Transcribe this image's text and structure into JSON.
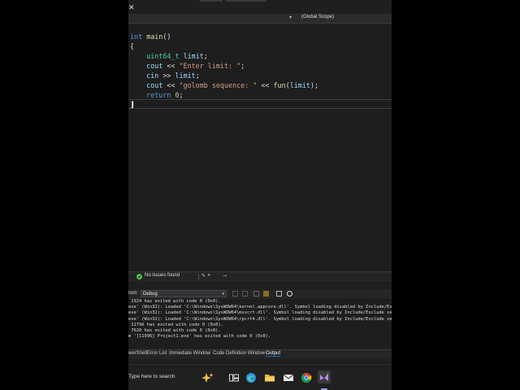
{
  "navigation": {
    "scope": "(Global Scope)",
    "arrow": "▾"
  },
  "editor": {
    "lines": [
      {
        "tokens": [
          {
            "t": "int",
            "c": "kw"
          },
          {
            "t": " "
          },
          {
            "t": "main",
            "c": "fn"
          },
          {
            "t": "()"
          }
        ]
      },
      {
        "tokens": [
          {
            "t": "{"
          }
        ]
      },
      {
        "tokens": []
      },
      {
        "tokens": [
          {
            "t": "    "
          },
          {
            "t": "uint64_t",
            "c": "ty"
          },
          {
            "t": " "
          },
          {
            "t": "limit",
            "c": "var"
          },
          {
            "t": ";"
          }
        ]
      },
      {
        "tokens": [
          {
            "t": "    "
          },
          {
            "t": "cout",
            "c": "var"
          },
          {
            "t": " << "
          },
          {
            "t": "\"Enter limit: \"",
            "c": "str"
          },
          {
            "t": ";"
          }
        ]
      },
      {
        "tokens": [
          {
            "t": "    "
          },
          {
            "t": "cin",
            "c": "var"
          },
          {
            "t": " >> "
          },
          {
            "t": "limit",
            "c": "var"
          },
          {
            "t": ";"
          }
        ]
      },
      {
        "tokens": [
          {
            "t": "    "
          },
          {
            "t": "cout",
            "c": "var"
          },
          {
            "t": " << "
          },
          {
            "t": "\"golomb sequence: \"",
            "c": "str"
          },
          {
            "t": " << "
          },
          {
            "t": "fun",
            "c": "fn"
          },
          {
            "t": "("
          },
          {
            "t": "limit",
            "c": "var"
          },
          {
            "t": ");"
          }
        ]
      },
      {
        "tokens": [
          {
            "t": "    "
          },
          {
            "t": "return",
            "c": "kw"
          },
          {
            "t": " "
          },
          {
            "t": "0",
            "c": "num"
          },
          {
            "t": ";"
          }
        ]
      },
      {
        "tokens": [
          {
            "t": "}"
          }
        ]
      }
    ]
  },
  "status": {
    "issues": "No issues found",
    "brush_arrow": "▾",
    "arrow": "→"
  },
  "output": {
    "from_label": "rom:",
    "source": "Debug",
    "lines": [
      " 1924 has exited with code 0 (0x0).",
      "exe' (Win32): Loaded 'C:\\Windows\\SysWOW64\\kernel.appcore.dll'. Symbol loading disabled by Include/Exc",
      "exe' (Win32): Loaded 'C:\\Windows\\SysWOW64\\msvcrt.dll'. Symbol loading disabled by Include/Exclude se",
      "exe' (Win32): Loaded 'C:\\Windows\\SysWOW64\\rpcrt4.dll'. Symbol loading disabled by Include/Exclude se",
      " 11796 has exited with code 0 (0x0).",
      " 7620 has exited with code 0 (0x0).",
      "m '[11996] Project1.exe' has exited with code 0 (0x0)."
    ]
  },
  "bottom_tabs": [
    {
      "label": "werShell",
      "active": false
    },
    {
      "label": "Error List",
      "active": false
    },
    {
      "label": "Immediate Window",
      "active": false
    },
    {
      "label": "Code Definition Window",
      "active": false
    },
    {
      "label": "Output",
      "active": true
    }
  ],
  "taskbar": {
    "search_placeholder": "Type here to search",
    "icons": [
      "copilot-icon",
      "task-view-icon",
      "edge-icon",
      "file-explorer-icon",
      "mail-icon",
      "chrome-icon",
      "visual-studio-icon"
    ]
  },
  "colors": {
    "editor_bg": "#1e1e1e",
    "keyword": "#569cd6",
    "type": "#4ec9b0",
    "function": "#dcdcaa",
    "string": "#d69d85",
    "variable": "#9cdcfe",
    "number": "#b5cea8",
    "accent": "#0e70c0"
  }
}
